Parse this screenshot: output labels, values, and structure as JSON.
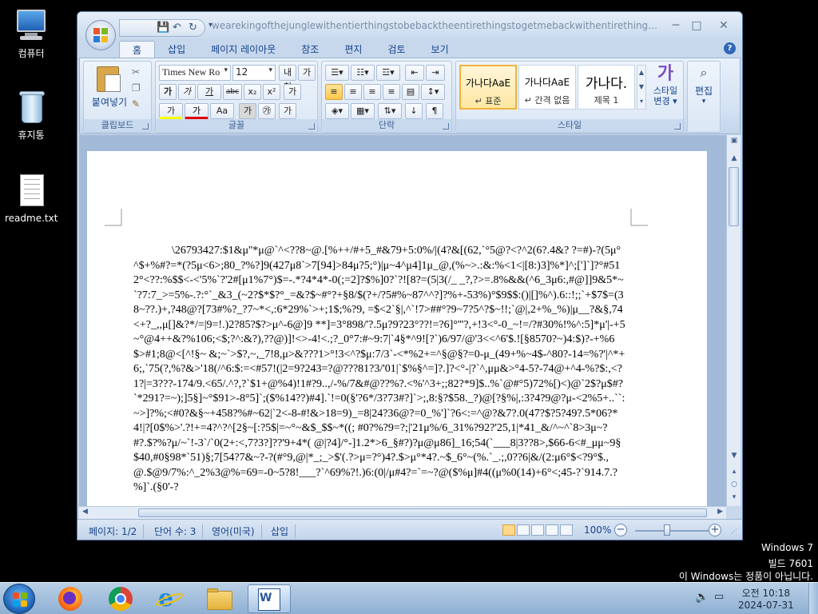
{
  "desktop": {
    "icons": [
      {
        "label": "컴퓨터",
        "icon": "computer-icon"
      },
      {
        "label": "휴지통",
        "icon": "recycle-bin-icon"
      },
      {
        "label": "readme.txt",
        "icon": "text-file-icon"
      }
    ]
  },
  "window": {
    "title": "wearekingofthejunglewithentierthingstobebacktheentirethingstogetmebackwithentirethingsweneedt...M...",
    "controls": {
      "minimize": "─",
      "maximize": "□",
      "close": "✕"
    },
    "qat": {
      "save": "💾",
      "undo": "↶",
      "redo": "↻",
      "customize": "▾"
    }
  },
  "ribbon": {
    "tabs": [
      "홈",
      "삽입",
      "페이지 레이아웃",
      "참조",
      "편지",
      "검토",
      "보기"
    ],
    "active_tab": "홈",
    "groups": {
      "clipboard": {
        "label": "클립보드",
        "paste": "붙여넣기"
      },
      "font": {
        "label": "글꼴",
        "font_name": "Times New Ro",
        "font_size": "12",
        "bold": "가",
        "italic": "가",
        "underline": "가",
        "strike": "abc",
        "sub": "x₂",
        "sup": "x²",
        "change_case": "Aa",
        "phonetic": "내천",
        "char_border": "가",
        "char_shade": "가",
        "enclose": "㉮",
        "grow": "가",
        "shrink": "가",
        "clear": "가"
      },
      "paragraph": {
        "label": "단락"
      },
      "styles": {
        "label": "스타일",
        "items": [
          {
            "preview": "가나다AaE",
            "name": "↵ 표준"
          },
          {
            "preview": "가나다AaE",
            "name": "↵ 간격 없음"
          },
          {
            "preview": "가나다.",
            "name": "제목 1"
          }
        ],
        "change_styles": "스타일\n변경",
        "change_styles_line1": "스타일",
        "change_styles_line2": "변경 ▾",
        "change_icon": "가"
      },
      "editing": {
        "label": "편집",
        "find": "편집"
      }
    }
  },
  "document": {
    "body": "\\26793427:$1&μ''*μ@`^<??8~@.[%++/#+5_#&79+5:0%/|(4?&[(62,`°5@?<?^2(6?.4&?\n?=#)-?(5μ°^$+%#?=*(?5μ<6>;80_?%?]9(427μ8`>7[94]>84μ?5;°)|μ~4^μ4]1μ_@,(%~>.:&:%<1<|[8:)3]%*]^;[']`]?°#512°<??:%$$<-<'5%`?'2#[μ1%7°)$=-.*?4*4*-0(;=2]?$%]0?`?![8?=(5|3(/_\n_?,?>=.8%&&(^6_3μ6:,#@]]9&5*~`?7:7_>=5%-.?:°`_&3_(~2?$*$?°_=&?$~#°?+§8/$(?+/?5#%~87^^?]?%+-53%)°$9$$:()|[]%^).6::!;;`+$7$=(38~??.)+,?48@?[73#%?_?7~*<,:6*29%`>+;1$;%?9,\n=$<2`§|,^`!7>##°?9~7?5^?$~!!;`@|,2+%_%)|μ__?&§,74<+?_,,μ[]&?*/=|9=!.)2?85?$?>μ^-6@]9\n**]=3°898/'?.5μ?9?23°??!=?6]°'''?,+!3<°-0_~!=/?#30%!%^:5]*μ'|-+5~°@4++&?%106;<$;?^:&?),??@)]!<>-4!<.;?_0°7:#~9:7|`4§*^9![?`)6/97/@'3<<^6'$.![§8570?~)4:$)?-+%6$>#1;8@<[^!§~\n&;~`>$?,~,_7!8,μ>&???1>°!3<^?$μ:7/3`-<*%2+=^§@§?=0-μ_(49+%~4$-^80?-14=%?'|^*+6;,`75(?,%?&>'18(/^6:$:=<#57!(|2=9?243=?@???81?3/'01|`$%§^=]?.]?<°-|?`^,μμ&>°4-5?-74@+^4-%?$:,<?1?|=3???-174/9.<65/.^?,?`$1+@%4)!1#?9..,/-%/7&#@??%?.<%'^3+;;82?*9]$..%`@#°5)72%[)<)@`2$?μ$#?`*291?=~);]5§]~°$91>-8°5]`;($%14??)#4].`!=0(§'?6*/3?73#?]`>;,8:§?$58._?)@[?§%|,:3?4?9@?μ-<2%5+..``:~>]?%;<#0?&§~+458?%#~62|`2<-8-#!&>18=9)_=8|24?36@?=0_%']`?6<:=^@?&7?.0(47?$?5?49?.5*06?*4!|?[0$%>'.?!+=4?^?^[2§~[:?5$|=~°~&$_$$~*((;\n#0?%?9=?;|'21μ%/6_31%?92?'25,1|*41_&/^~^`8>3μ~?#?.$?%?μ/~`!-3`/`0(2+:<,7?3?]??'9+4*(\n@|?4]/°-]1.2*>6_§#?)?μ@μ86]_16;54(`___8|3??8>,$66-6<#_μμ~9§$40,#0§98*`51)§;7[54?7&~?-?(#°9,@|*_;_>$'(.?>μ=?°)4?.$>μ°*4?.~$_6°~(%.`_.;,0??6|&/(2:μ6°$<?9°$.,@.$@9/7%:^_2%3@%=69=-0~5?8!___?`^69%?!.)6:(0|/μ#4?=`=~?@($%μ]#4((μ%0(14)+6°<;45-?`914.7.?%]`.(§0'-?"
  },
  "status_bar": {
    "page": "페이지: 1/2",
    "words": "단어 수: 3",
    "language": "영어(미국)",
    "mode": "삽입",
    "zoom": "100%",
    "zoom_out": "−",
    "zoom_in": "+"
  },
  "watermark": {
    "line1": "Windows 7",
    "line2": "빌드 7601",
    "line3": "이 Windows는 정품이 아닙니다."
  },
  "taskbar": {
    "apps": [
      "firefox-icon",
      "chrome-icon",
      "internet-explorer-icon",
      "file-explorer-icon",
      "word-icon"
    ],
    "time": "오전 10:18",
    "date": "2024-07-31"
  }
}
